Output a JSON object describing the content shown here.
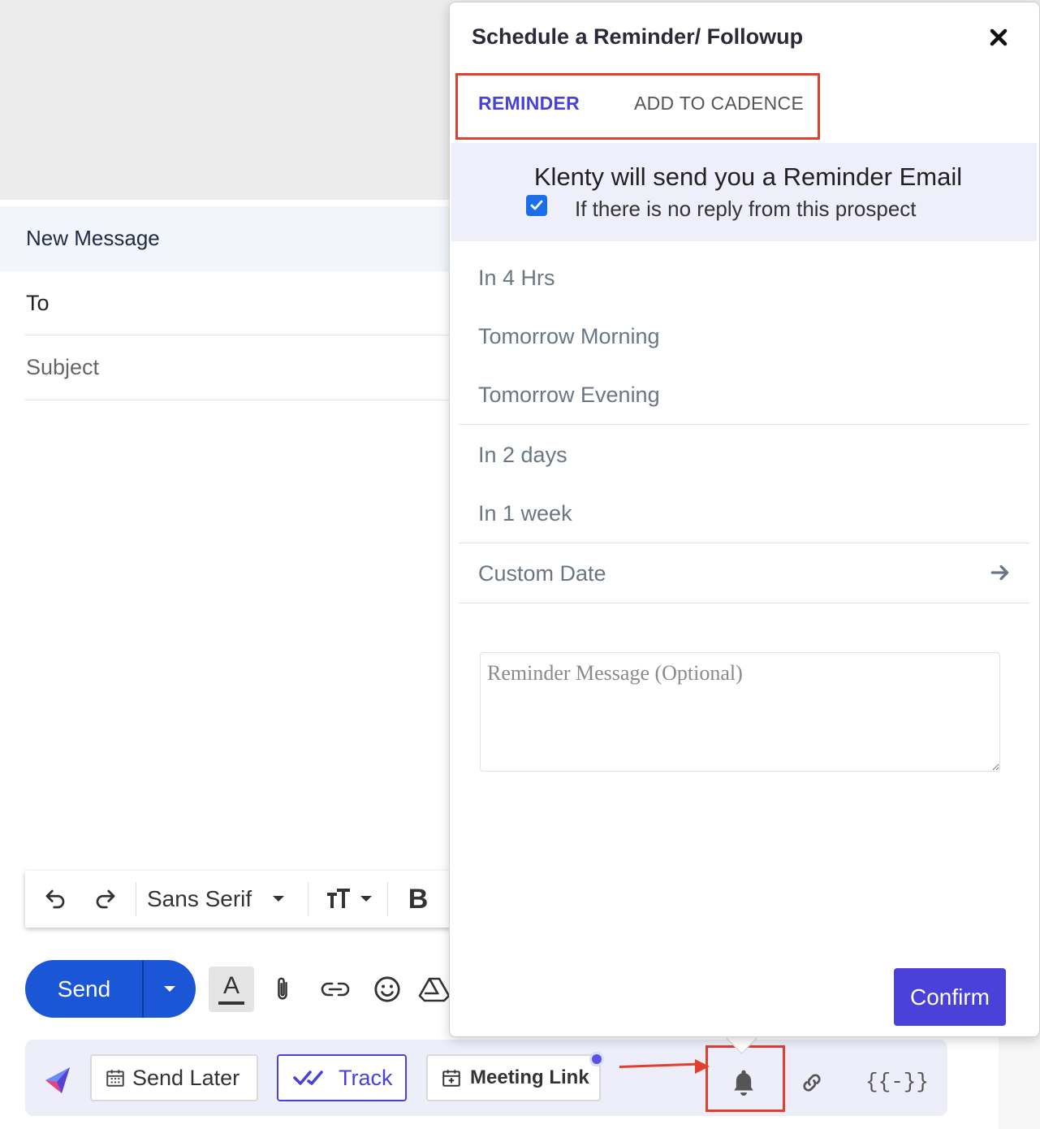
{
  "compose": {
    "title": "New Message",
    "to_label": "To",
    "subject_label": "Subject"
  },
  "format_toolbar": {
    "font_name": "Sans Serif",
    "bold_label": "B"
  },
  "send_row": {
    "send_label": "Send",
    "text_color_label": "A"
  },
  "klenty_bar": {
    "send_later_label": "Send Later",
    "track_label": "Track",
    "meeting_link_label": "Meeting Link",
    "template_label": "{{-}}"
  },
  "popup": {
    "title": "Schedule a Reminder/ Followup",
    "tabs": [
      {
        "label": "REMINDER",
        "active": true
      },
      {
        "label": "ADD TO CADENCE",
        "active": false
      }
    ],
    "info_title": "Klenty will send you a Reminder Email",
    "info_checkbox_checked": true,
    "info_sub": "If there is no reply from this prospect",
    "options": [
      {
        "label": "In 4 Hrs"
      },
      {
        "label": "Tomorrow Morning"
      },
      {
        "label": "Tomorrow Evening"
      },
      {
        "label": "In 2 days"
      },
      {
        "label": "In 1 week"
      },
      {
        "label": "Custom Date"
      }
    ],
    "message_placeholder": "Reminder Message (Optional)",
    "confirm_label": "Confirm"
  },
  "colors": {
    "accent": "#4a42d8",
    "send_blue": "#1a56d6",
    "highlight_red": "#e0402d",
    "info_band": "#efeefb"
  }
}
